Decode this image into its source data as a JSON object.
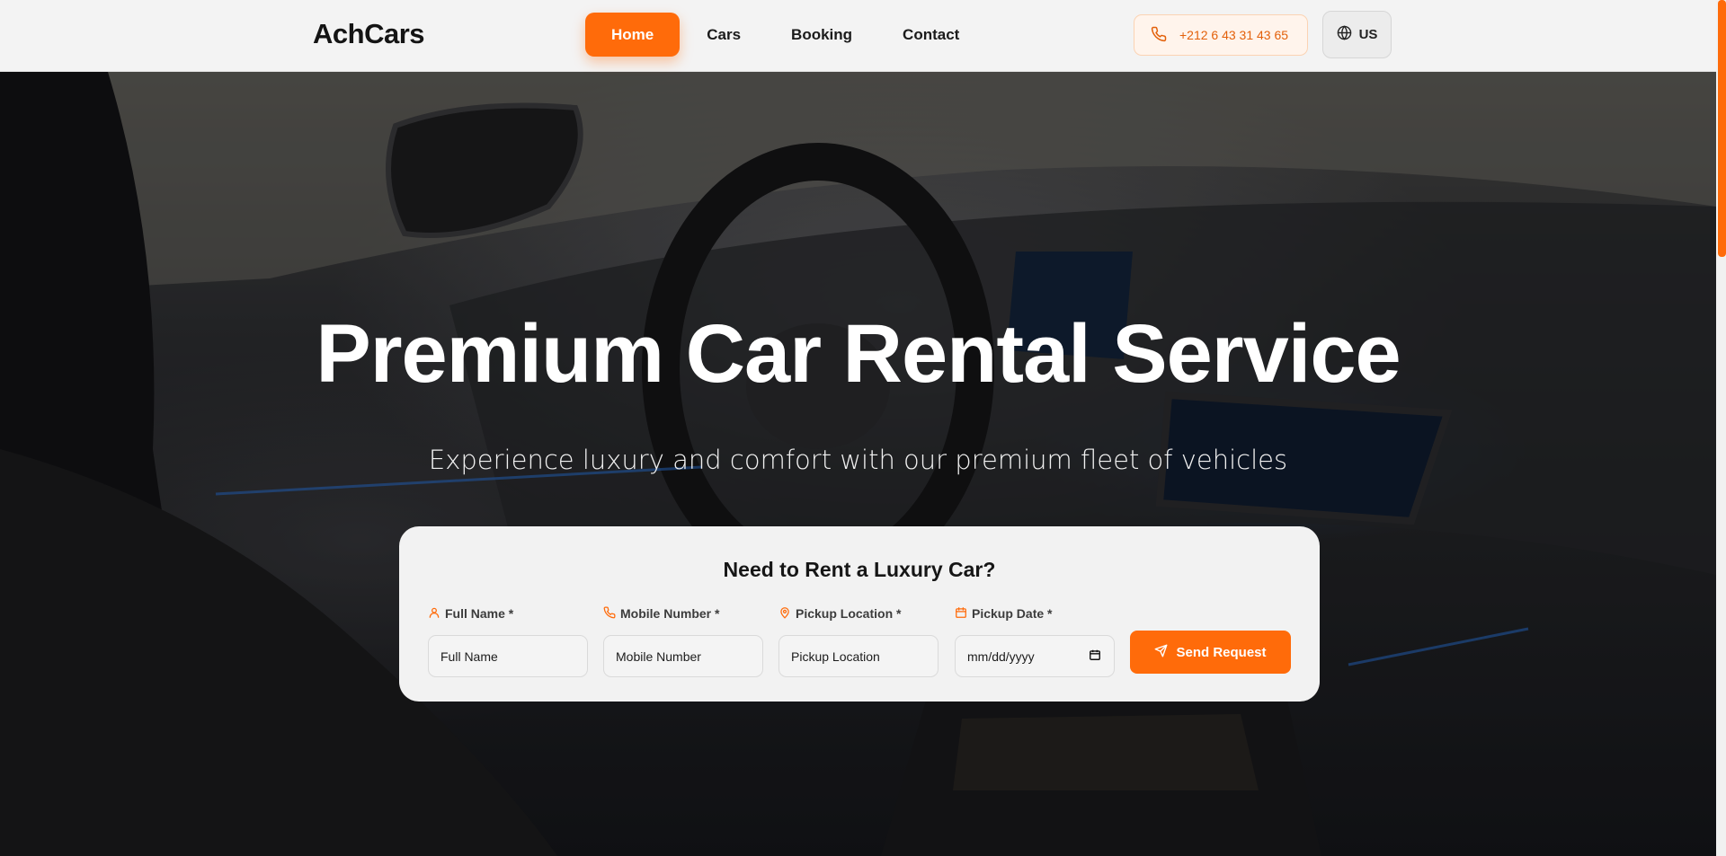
{
  "header": {
    "logo": "AchCars",
    "nav": [
      {
        "label": "Home",
        "active": true
      },
      {
        "label": "Cars",
        "active": false
      },
      {
        "label": "Booking",
        "active": false
      },
      {
        "label": "Contact",
        "active": false
      }
    ],
    "phone": "+212 6 43 31 43 65",
    "language": "US"
  },
  "hero": {
    "title": "Premium Car Rental Service",
    "subtitle": "Experience luxury and comfort with our premium fleet of vehicles"
  },
  "form": {
    "title": "Need to Rent a Luxury Car?",
    "fields": [
      {
        "label": "Full Name *",
        "placeholder": "Full Name",
        "icon": "user-icon"
      },
      {
        "label": "Mobile Number *",
        "placeholder": "Mobile Number",
        "icon": "phone-icon"
      },
      {
        "label": "Pickup Location *",
        "placeholder": "Pickup Location",
        "icon": "map-pin-icon"
      },
      {
        "label": "Pickup Date *",
        "placeholder": "mm/dd/yyyy",
        "icon": "calendar-icon"
      }
    ],
    "submit_label": "Send Request"
  },
  "colors": {
    "accent": "#ff6b0a",
    "header_bg": "#f3f3f3",
    "card_bg": "#f2f2f2"
  }
}
